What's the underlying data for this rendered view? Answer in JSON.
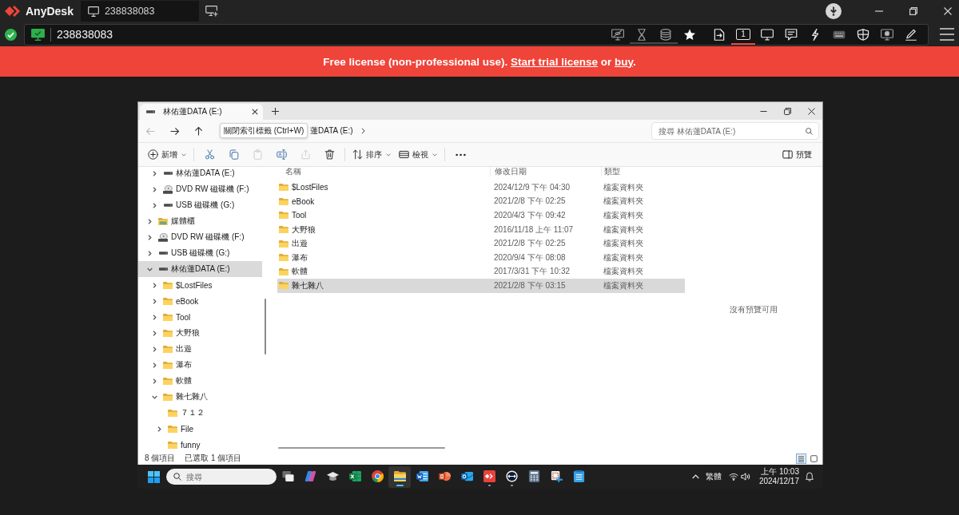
{
  "anydesk": {
    "app_name": "AnyDesk",
    "session_tabs": [
      {
        "label": "238838083",
        "selected": true
      }
    ],
    "connected": true,
    "address_field": {
      "value": "238838083"
    },
    "display_switch": {
      "label": "1",
      "selected": true
    },
    "banner": {
      "text": "Free license (non-professional use).",
      "trial_link": "Start trial license",
      "conjunction": "or",
      "buy_link": "buy",
      "end": "."
    }
  },
  "explorer": {
    "tabs": [
      {
        "label": "林佑蓮DATA (E:)",
        "selected": true
      }
    ],
    "nav_buttons": [
      {
        "kind": "back",
        "disabled": true
      },
      {
        "kind": "forward",
        "disabled": false
      },
      {
        "kind": "up",
        "disabled": false
      }
    ],
    "tooltip": "關閉索引標籤 (Ctrl+W)",
    "breadcrumb": [
      "蓮DATA (E:)"
    ],
    "search": {
      "placeholder": "搜尋 林佑蓮DATA (E:)"
    },
    "commands": [
      {
        "kind": "new",
        "label": "新增",
        "disabled": false
      },
      {
        "kind": "cut",
        "disabled": false
      },
      {
        "kind": "copy",
        "disabled": false
      },
      {
        "kind": "paste",
        "disabled": true
      },
      {
        "kind": "rename",
        "disabled": false
      },
      {
        "kind": "share",
        "disabled": true
      },
      {
        "kind": "delete",
        "disabled": false
      },
      {
        "kind": "sort",
        "label": "排序",
        "disabled": false
      },
      {
        "kind": "view",
        "label": "檢視",
        "disabled": false
      },
      {
        "kind": "more",
        "disabled": false
      }
    ],
    "preview_button": "預覽",
    "nav_tree": {
      "branch_above": [
        {
          "label": "林佑蓮DATA (E:)",
          "kind": "drive",
          "expandable": true,
          "expanded": false,
          "selected": false
        },
        {
          "label": "DVD RW 磁碟機 (F:)",
          "kind": "disc",
          "expandable": true,
          "expanded": false,
          "selected": false
        },
        {
          "label": "USB 磁碟機 (G:)",
          "kind": "drive",
          "expandable": true,
          "expanded": false,
          "selected": false
        }
      ],
      "items": [
        {
          "label": "媒體櫃",
          "kind": "library",
          "expandable": true,
          "expanded": false,
          "selected": false
        },
        {
          "label": "DVD RW 磁碟機 (F:)",
          "kind": "disc",
          "expandable": true,
          "expanded": false,
          "selected": false
        },
        {
          "label": "USB 磁碟機 (G:)",
          "kind": "drive",
          "expandable": true,
          "expanded": false,
          "selected": false
        },
        {
          "label": "林佑蓮DATA (E:)",
          "kind": "drive",
          "expandable": true,
          "expanded": true,
          "selected": true,
          "children": [
            {
              "label": "$LostFiles",
              "kind": "folder",
              "expandable": true,
              "expanded": false,
              "selected": false
            },
            {
              "label": "eBook",
              "kind": "folder",
              "expandable": true,
              "expanded": false,
              "selected": false
            },
            {
              "label": "Tool",
              "kind": "folder",
              "expandable": true,
              "expanded": false,
              "selected": false
            },
            {
              "label": "大野狼",
              "kind": "folder",
              "expandable": true,
              "expanded": false,
              "selected": false
            },
            {
              "label": "出遊",
              "kind": "folder",
              "expandable": true,
              "expanded": false,
              "selected": false
            },
            {
              "label": "瀑布",
              "kind": "folder",
              "expandable": true,
              "expanded": false,
              "selected": false
            },
            {
              "label": "軟體",
              "kind": "folder",
              "expandable": true,
              "expanded": false,
              "selected": false
            },
            {
              "label": "雜七雜八",
              "kind": "folder",
              "expandable": true,
              "expanded": true,
              "selected": false,
              "children": [
                {
                  "label": "７１２",
                  "kind": "folder",
                  "expandable": false,
                  "expanded": false,
                  "selected": false
                },
                {
                  "label": "File",
                  "kind": "folder",
                  "expandable": true,
                  "expanded": false,
                  "selected": false
                },
                {
                  "label": "funny",
                  "kind": "folder",
                  "expandable": false,
                  "expanded": false,
                  "selected": false
                }
              ]
            }
          ]
        }
      ]
    },
    "file_list": {
      "columns": [
        "名稱",
        "修改日期",
        "類型"
      ],
      "rows": [
        {
          "name": "$LostFiles",
          "modified": "2024/12/9 下午 04:30",
          "type": "檔案資料夾",
          "selected": false
        },
        {
          "name": "eBook",
          "modified": "2021/2/8 下午 02:25",
          "type": "檔案資料夾",
          "selected": false
        },
        {
          "name": "Tool",
          "modified": "2020/4/3 下午 09:42",
          "type": "檔案資料夾",
          "selected": false
        },
        {
          "name": "大野狼",
          "modified": "2016/11/18 上午 11:07",
          "type": "檔案資料夾",
          "selected": false
        },
        {
          "name": "出遊",
          "modified": "2021/2/8 下午 02:25",
          "type": "檔案資料夾",
          "selected": false
        },
        {
          "name": "瀑布",
          "modified": "2020/9/4 下午 08:08",
          "type": "檔案資料夾",
          "selected": false
        },
        {
          "name": "軟體",
          "modified": "2017/3/31 下午 10:32",
          "type": "檔案資料夾",
          "selected": false
        },
        {
          "name": "雜七雜八",
          "modified": "2021/2/8 下午 03:15",
          "type": "檔案資料夾",
          "selected": true
        }
      ]
    },
    "preview_pane": {
      "message": "沒有預覽可用"
    },
    "status_bar": {
      "item_count": "8 個項目",
      "selection": "已選取 1 個項目",
      "views": [
        {
          "kind": "details",
          "selected": true
        },
        {
          "kind": "tiles",
          "selected": false
        }
      ]
    }
  },
  "taskbar": {
    "search": {
      "placeholder": "搜尋"
    },
    "apps": [
      {
        "kind": "task-view",
        "running": false,
        "focused": false
      },
      {
        "kind": "assistant",
        "running": false,
        "focused": false
      },
      {
        "kind": "cap",
        "running": false,
        "focused": false
      },
      {
        "kind": "spreadsheet",
        "running": false,
        "focused": false
      },
      {
        "kind": "browser",
        "running": false,
        "focused": false
      },
      {
        "kind": "files",
        "running": true,
        "focused": true
      },
      {
        "kind": "document",
        "running": false,
        "focused": false
      },
      {
        "kind": "presentation",
        "running": false,
        "focused": false
      },
      {
        "kind": "mail",
        "running": false,
        "focused": false
      },
      {
        "kind": "remote",
        "running": true,
        "focused": false
      },
      {
        "kind": "circle",
        "running": true,
        "focused": false
      },
      {
        "kind": "calculator",
        "running": false,
        "focused": false
      },
      {
        "kind": "snip",
        "running": false,
        "focused": false
      },
      {
        "kind": "notepad",
        "running": false,
        "focused": false
      }
    ],
    "tray": {
      "input_method": "繁體",
      "time": "上午 10:03",
      "date": "2024/12/17"
    }
  }
}
